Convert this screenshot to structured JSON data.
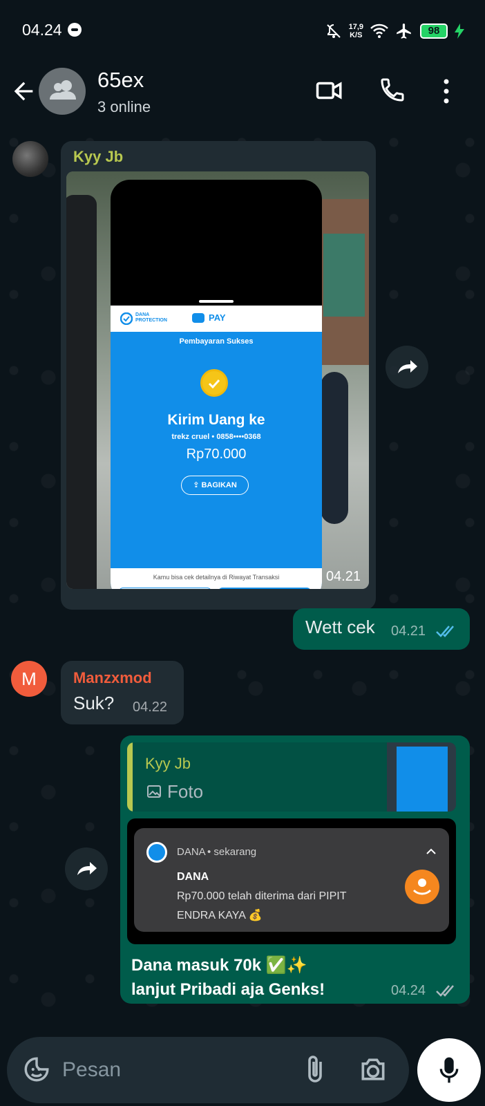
{
  "status_bar": {
    "time": "04.24",
    "speed_value": "17,9",
    "speed_unit": "K/S",
    "battery": "98"
  },
  "header": {
    "title": "65ex",
    "subtitle": "3 online"
  },
  "messages": {
    "m1": {
      "sender": "Kyy Jb",
      "time": "04.21",
      "receipt": {
        "dana_protection": "DANA PROTECTION",
        "pay": "PAY",
        "status": "Pembayaran Sukses",
        "title": "Kirim Uang ke",
        "recipient": "trekz cruel • 0858••••0368",
        "amount": "Rp70.000",
        "share": "BAGIKAN",
        "footer": "Kamu bisa cek detailnya di Riwayat Transaksi"
      }
    },
    "m2": {
      "text": "Wett cek",
      "time": "04.21"
    },
    "m3": {
      "avatar_letter": "M",
      "sender": "Manzxmod",
      "text": "Suk?",
      "time": "04.22"
    },
    "m4": {
      "quote_sender": "Kyy Jb",
      "quote_text": "Foto",
      "notif_app": "DANA",
      "notif_when": "• sekarang",
      "notif_title": "DANA",
      "notif_body_1": "Rp70.000 telah diterima dari PIPIT",
      "notif_body_2": "ENDRA KAYA 💰",
      "text_1": "Dana masuk 70k ✅✨",
      "text_2": "lanjut Pribadi aja Genks!",
      "time": "04.24"
    }
  },
  "input": {
    "placeholder": "Pesan"
  },
  "colors": {
    "background": "#0b141a",
    "incoming_bubble": "#202c33",
    "outgoing_bubble": "#005c4b",
    "sender_kyy": "#b8c850",
    "sender_manz": "#f15c3c",
    "read_ticks": "#53bdeb",
    "dana_blue": "#118ee9"
  }
}
